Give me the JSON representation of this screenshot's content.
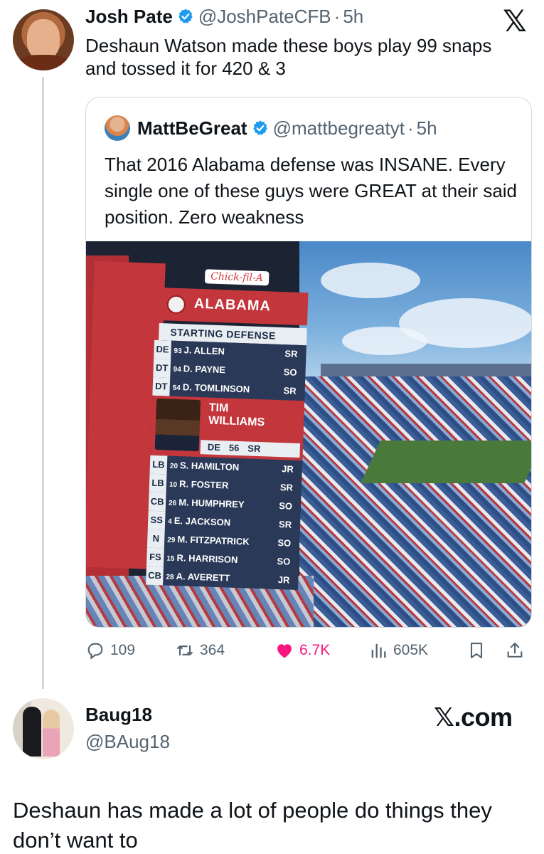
{
  "app": {
    "logo_glyph": "𝕏"
  },
  "main_tweet": {
    "author_name": "Josh Pate",
    "handle": "@JoshPateCFB",
    "separator": "·",
    "time": "5h",
    "text": "Deshaun Watson made these boys play 99 snaps and tossed it for 420 & 3",
    "verified_color": "#1d9bf0"
  },
  "quote": {
    "author_name": "MattBeGreat",
    "handle": "@mattbegreatyt",
    "separator": "·",
    "time": "5h",
    "text": "That 2016 Alabama defense was INSANE. Every single one of these guys were GREAT at their said position. Zero weakness",
    "image": {
      "sponsor": "Chick-fil-A",
      "team": "ALABAMA",
      "subtitle": "STARTING DEFENSE",
      "rows_top": [
        {
          "pos": "DE",
          "num": "93",
          "name": "J. ALLEN",
          "yr": "SR"
        },
        {
          "pos": "DT",
          "num": "94",
          "name": "D. PAYNE",
          "yr": "SO"
        },
        {
          "pos": "DT",
          "num": "54",
          "name": "D. TOMLINSON",
          "yr": "SR"
        }
      ],
      "featured": {
        "first": "TIM",
        "last": "WILLIAMS",
        "pos": "DE",
        "num": "56",
        "yr": "SR"
      },
      "rows_bottom": [
        {
          "pos": "LB",
          "num": "20",
          "name": "S. HAMILTON",
          "yr": "JR"
        },
        {
          "pos": "LB",
          "num": "10",
          "name": "R. FOSTER",
          "yr": "SR"
        },
        {
          "pos": "CB",
          "num": "26",
          "name": "M. HUMPHREY",
          "yr": "SO"
        },
        {
          "pos": "SS",
          "num": "4",
          "name": "E. JACKSON",
          "yr": "SR"
        },
        {
          "pos": "N",
          "num": "29",
          "name": "M. FITZPATRICK",
          "yr": "SO"
        },
        {
          "pos": "FS",
          "num": "15",
          "name": "R. HARRISON",
          "yr": "SO"
        },
        {
          "pos": "CB",
          "num": "28",
          "name": "A. AVERETT",
          "yr": "JR"
        }
      ]
    }
  },
  "actions": {
    "replies": "109",
    "reposts": "364",
    "likes": "6.7K",
    "views": "605K",
    "like_color": "#f91880",
    "icons": [
      "reply-icon",
      "repost-icon",
      "like-icon",
      "views-icon",
      "bookmark-icon",
      "share-icon"
    ]
  },
  "reply": {
    "author_name": "Baug18",
    "handle": "@BAug18",
    "site_label": "𝕏.com",
    "text": "Deshaun has made a lot of people do things they don’t want to"
  }
}
